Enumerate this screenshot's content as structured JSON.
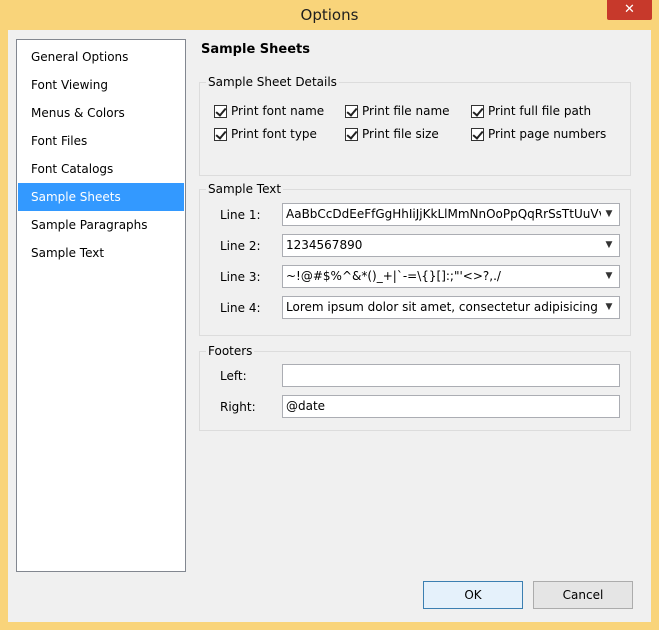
{
  "window": {
    "title": "Options",
    "close_glyph": "✕"
  },
  "nav": {
    "items": [
      {
        "label": "General Options"
      },
      {
        "label": "Font Viewing"
      },
      {
        "label": "Menus & Colors"
      },
      {
        "label": "Font Files"
      },
      {
        "label": "Font Catalogs"
      },
      {
        "label": "Sample Sheets"
      },
      {
        "label": "Sample Paragraphs"
      },
      {
        "label": "Sample Text"
      }
    ],
    "selected": "Sample Sheets"
  },
  "panel": {
    "title": "Sample Sheets"
  },
  "details": {
    "label": "Sample Sheet Details",
    "checkboxes": [
      {
        "label": "Print font name",
        "checked": true
      },
      {
        "label": "Print file name",
        "checked": true
      },
      {
        "label": "Print full file path",
        "checked": true
      },
      {
        "label": "Print font type",
        "checked": true
      },
      {
        "label": "Print file size",
        "checked": true
      },
      {
        "label": "Print page numbers",
        "checked": true
      }
    ]
  },
  "sample_text": {
    "label": "Sample Text",
    "lines": [
      {
        "label": "Line 1:",
        "value": "AaBbCcDdEeFfGgHhIiJjKkLlMmNnOoPpQqRrSsTtUuVvWwXxYyZz"
      },
      {
        "label": "Line 2:",
        "value": "1234567890"
      },
      {
        "label": "Line 3:",
        "value": "~!@#$%^&*()_+|`-=\\{}[]:;\"'<>?,./"
      },
      {
        "label": "Line 4:",
        "value": "Lorem ipsum dolor sit amet, consectetur adipisicing elit, sed do eiusmod"
      }
    ]
  },
  "footers": {
    "label": "Footers",
    "left_label": "Left:",
    "left_value": "",
    "right_label": "Right:",
    "right_value": "@date"
  },
  "buttons": {
    "ok": "OK",
    "cancel": "Cancel"
  }
}
